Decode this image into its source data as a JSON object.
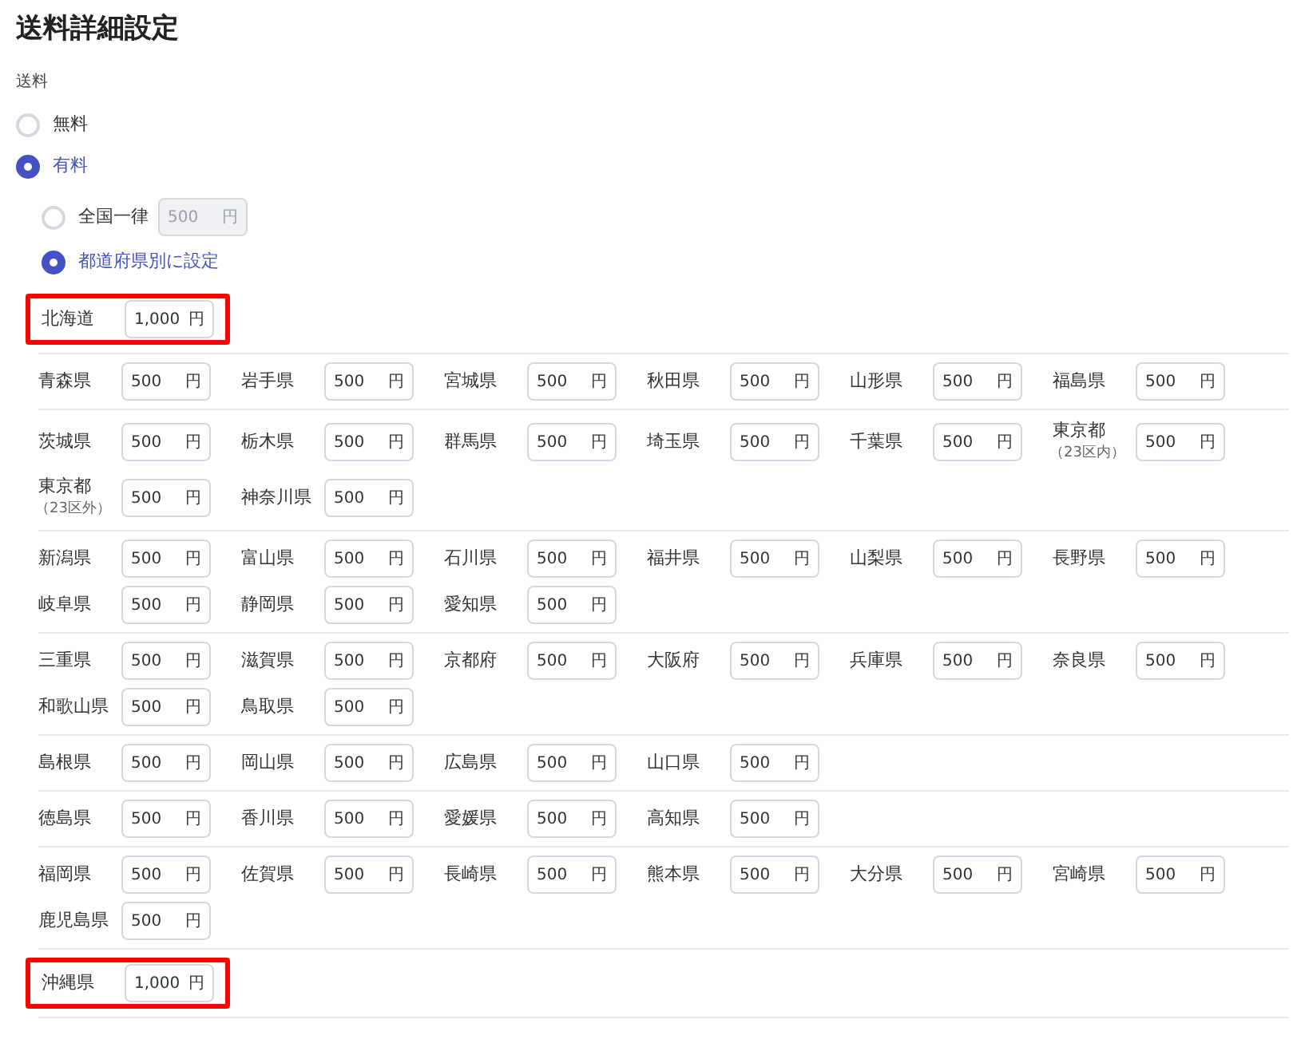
{
  "title": "送料詳細設定",
  "fee_label": "送料",
  "fee_options": [
    {
      "label": "無料",
      "selected": false
    },
    {
      "label": "有料",
      "selected": true
    }
  ],
  "rate_options": [
    {
      "kind": "flat",
      "label": "全国一律",
      "selected": false,
      "field": {
        "placeholder": "500",
        "unit": "円",
        "disabled": true
      }
    },
    {
      "kind": "by_prefecture",
      "label": "都道府県別に設定",
      "selected": true
    }
  ],
  "regions": [
    {
      "highlighted": true,
      "prefectures": [
        {
          "name": "北海道",
          "value": "1,000",
          "unit": "円"
        }
      ]
    },
    {
      "highlighted": false,
      "prefectures": [
        {
          "name": "青森県",
          "value": "500",
          "unit": "円"
        },
        {
          "name": "岩手県",
          "value": "500",
          "unit": "円"
        },
        {
          "name": "宮城県",
          "value": "500",
          "unit": "円"
        },
        {
          "name": "秋田県",
          "value": "500",
          "unit": "円"
        },
        {
          "name": "山形県",
          "value": "500",
          "unit": "円"
        },
        {
          "name": "福島県",
          "value": "500",
          "unit": "円"
        }
      ]
    },
    {
      "highlighted": false,
      "prefectures": [
        {
          "name": "茨城県",
          "value": "500",
          "unit": "円"
        },
        {
          "name": "栃木県",
          "value": "500",
          "unit": "円"
        },
        {
          "name": "群馬県",
          "value": "500",
          "unit": "円"
        },
        {
          "name": "埼玉県",
          "value": "500",
          "unit": "円"
        },
        {
          "name": "千葉県",
          "value": "500",
          "unit": "円"
        },
        {
          "name": "東京都",
          "note": "（23区内）",
          "value": "500",
          "unit": "円"
        },
        {
          "name": "東京都",
          "note": "（23区外）",
          "value": "500",
          "unit": "円"
        },
        {
          "name": "神奈川県",
          "value": "500",
          "unit": "円"
        }
      ]
    },
    {
      "highlighted": false,
      "prefectures": [
        {
          "name": "新潟県",
          "value": "500",
          "unit": "円"
        },
        {
          "name": "富山県",
          "value": "500",
          "unit": "円"
        },
        {
          "name": "石川県",
          "value": "500",
          "unit": "円"
        },
        {
          "name": "福井県",
          "value": "500",
          "unit": "円"
        },
        {
          "name": "山梨県",
          "value": "500",
          "unit": "円"
        },
        {
          "name": "長野県",
          "value": "500",
          "unit": "円"
        },
        {
          "name": "岐阜県",
          "value": "500",
          "unit": "円"
        },
        {
          "name": "静岡県",
          "value": "500",
          "unit": "円"
        },
        {
          "name": "愛知県",
          "value": "500",
          "unit": "円"
        }
      ]
    },
    {
      "highlighted": false,
      "prefectures": [
        {
          "name": "三重県",
          "value": "500",
          "unit": "円"
        },
        {
          "name": "滋賀県",
          "value": "500",
          "unit": "円"
        },
        {
          "name": "京都府",
          "value": "500",
          "unit": "円"
        },
        {
          "name": "大阪府",
          "value": "500",
          "unit": "円"
        },
        {
          "name": "兵庫県",
          "value": "500",
          "unit": "円"
        },
        {
          "name": "奈良県",
          "value": "500",
          "unit": "円"
        },
        {
          "name": "和歌山県",
          "value": "500",
          "unit": "円"
        },
        {
          "name": "鳥取県",
          "value": "500",
          "unit": "円"
        }
      ]
    },
    {
      "highlighted": false,
      "prefectures": [
        {
          "name": "島根県",
          "value": "500",
          "unit": "円"
        },
        {
          "name": "岡山県",
          "value": "500",
          "unit": "円"
        },
        {
          "name": "広島県",
          "value": "500",
          "unit": "円"
        },
        {
          "name": "山口県",
          "value": "500",
          "unit": "円"
        }
      ]
    },
    {
      "highlighted": false,
      "prefectures": [
        {
          "name": "徳島県",
          "value": "500",
          "unit": "円"
        },
        {
          "name": "香川県",
          "value": "500",
          "unit": "円"
        },
        {
          "name": "愛媛県",
          "value": "500",
          "unit": "円"
        },
        {
          "name": "高知県",
          "value": "500",
          "unit": "円"
        }
      ]
    },
    {
      "highlighted": false,
      "prefectures": [
        {
          "name": "福岡県",
          "value": "500",
          "unit": "円"
        },
        {
          "name": "佐賀県",
          "value": "500",
          "unit": "円"
        },
        {
          "name": "長崎県",
          "value": "500",
          "unit": "円"
        },
        {
          "name": "熊本県",
          "value": "500",
          "unit": "円"
        },
        {
          "name": "大分県",
          "value": "500",
          "unit": "円"
        },
        {
          "name": "宮崎県",
          "value": "500",
          "unit": "円"
        },
        {
          "name": "鹿児島県",
          "value": "500",
          "unit": "円"
        }
      ]
    },
    {
      "highlighted": true,
      "prefectures": [
        {
          "name": "沖縄県",
          "value": "1,000",
          "unit": "円"
        }
      ]
    }
  ]
}
